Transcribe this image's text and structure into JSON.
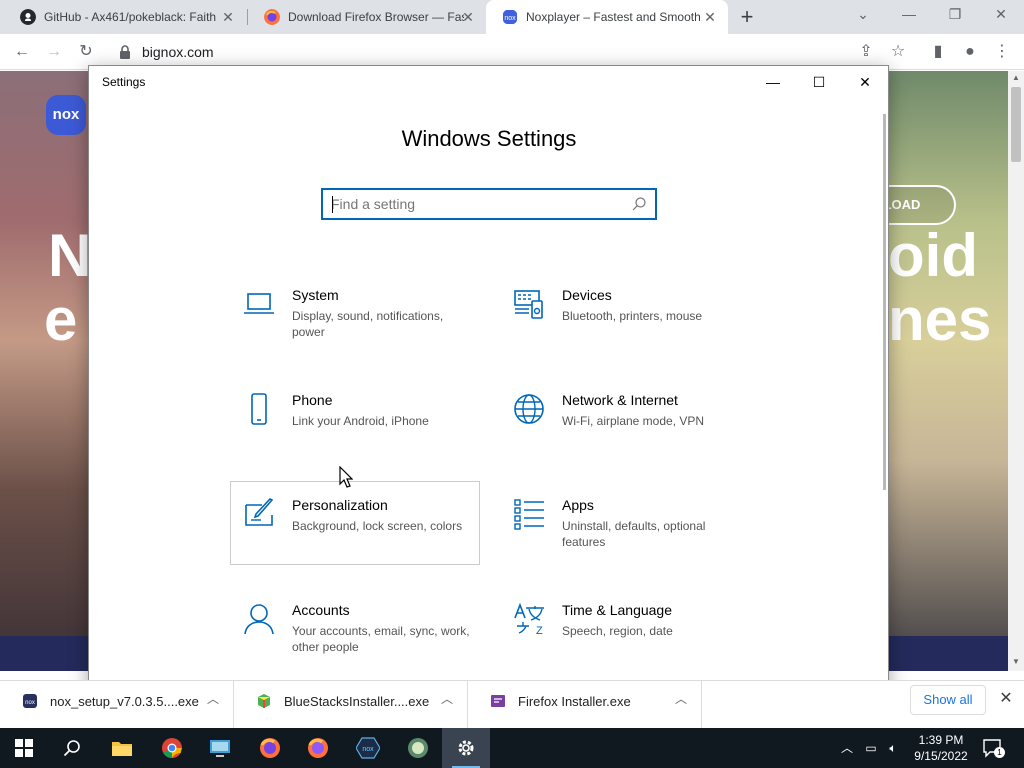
{
  "browser": {
    "tabs": [
      {
        "title": "GitHub - Ax461/pokeblack: Faith",
        "icon": "github-icon"
      },
      {
        "title": "Download Firefox Browser — Fas",
        "icon": "firefox-icon"
      },
      {
        "title": "Noxplayer – Fastest and Smooth",
        "icon": "nox-icon",
        "active": true
      }
    ],
    "url": "bignox.com"
  },
  "webpage": {
    "logo_text": "nox",
    "hero_left_1": "N",
    "hero_left_2": "e",
    "hero_right_1": "oid",
    "hero_right_2": "nes",
    "download_label": "LOAD"
  },
  "settings_window": {
    "title": "Settings",
    "heading": "Windows Settings",
    "search_placeholder": "Find a setting",
    "categories": [
      {
        "name": "System",
        "desc": "Display, sound, notifications, power",
        "icon": "laptop-icon"
      },
      {
        "name": "Devices",
        "desc": "Bluetooth, printers, mouse",
        "icon": "devices-icon"
      },
      {
        "name": "Phone",
        "desc": "Link your Android, iPhone",
        "icon": "phone-icon"
      },
      {
        "name": "Network & Internet",
        "desc": "Wi-Fi, airplane mode, VPN",
        "icon": "globe-icon"
      },
      {
        "name": "Personalization",
        "desc": "Background, lock screen, colors",
        "icon": "paint-icon"
      },
      {
        "name": "Apps",
        "desc": "Uninstall, defaults, optional features",
        "icon": "apps-list-icon"
      },
      {
        "name": "Accounts",
        "desc": "Your accounts, email, sync, work, other people",
        "icon": "person-icon"
      },
      {
        "name": "Time & Language",
        "desc": "Speech, region, date",
        "icon": "time-language-icon"
      }
    ]
  },
  "downloads": {
    "items": [
      {
        "name": "nox_setup_v7.0.3.5....exe"
      },
      {
        "name": "BlueStacksInstaller....exe"
      },
      {
        "name": "Firefox Installer.exe"
      }
    ],
    "show_all": "Show all"
  },
  "taskbar": {
    "time": "1:39 PM",
    "date": "9/15/2022",
    "notification_count": "1"
  },
  "colors": {
    "accent": "#0067b8",
    "taskbar": "#101820",
    "link": "#1a73e8"
  }
}
